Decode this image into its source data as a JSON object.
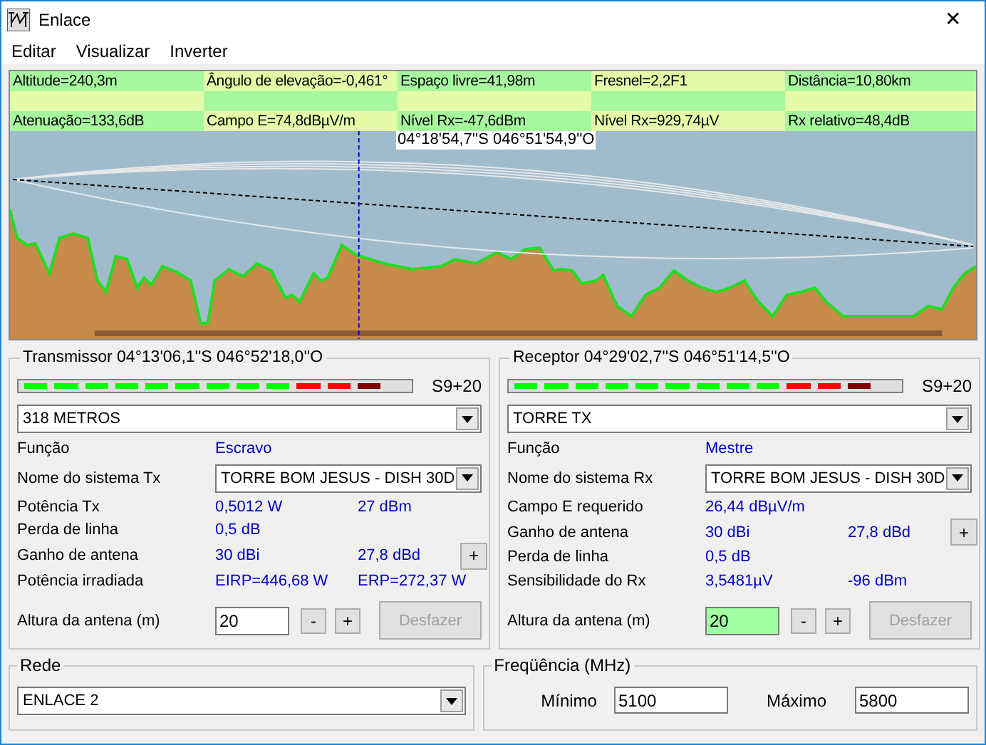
{
  "window": {
    "title": "Enlace",
    "close": "✕"
  },
  "menu": [
    "Editar",
    "Visualizar",
    "Inverter"
  ],
  "info_rows": [
    [
      "Altitude=240,3m",
      "Ângulo de elevação=-0,461°",
      "Espaço livre=41,98m",
      "Fresnel=2,2F1",
      "Distância=10,80km"
    ],
    [
      "Atenuação=133,6dB",
      "Campo E=74,8dBµV/m",
      "Nível Rx=-47,6dBm",
      "Nível Rx=929,74µV",
      "Rx relativo=48,4dB"
    ]
  ],
  "profile": {
    "cursor_label": "04°18'54,7''S 046°51'54,9''O"
  },
  "transmitter": {
    "title": "Transmissor 04°13'06,1''S 046°52'18,0''O",
    "meter": {
      "level": 0.92,
      "reading": "S9+20"
    },
    "site": "318 METROS",
    "rows": [
      {
        "kind": "text",
        "label": "Função",
        "values": [
          "Escravo"
        ]
      },
      {
        "kind": "combo",
        "label": "Nome do sistema Tx",
        "value": "TORRE BOM JESUS - DISH 30D"
      },
      {
        "kind": "text",
        "label": "Potência Tx",
        "values": [
          "0,5012 W",
          "27 dBm"
        ]
      },
      {
        "kind": "text",
        "label": "Perda de linha",
        "values": [
          "0,5 dB"
        ]
      },
      {
        "kind": "button",
        "label": "Ganho de antena",
        "values": [
          "30 dBi",
          "27,8 dBd"
        ],
        "button": "+"
      },
      {
        "kind": "text",
        "label": "Potência irradiada",
        "values": [
          "EIRP=446,68 W",
          "ERP=272,37 W"
        ]
      }
    ],
    "antenna": {
      "label": "Altura da antena (m)",
      "value": "20",
      "highlighted": false,
      "buttons": [
        "-",
        "+"
      ],
      "undo": {
        "label": "Desfazer",
        "disabled": true
      }
    }
  },
  "receiver": {
    "title": "Receptor 04°29'02,7''S 046°51'14,5''O",
    "meter": {
      "level": 0.92,
      "reading": "S9+20"
    },
    "site": "TORRE TX",
    "rows": [
      {
        "kind": "text",
        "label": "Função",
        "values": [
          "Mestre"
        ]
      },
      {
        "kind": "combo",
        "label": "Nome do sistema Rx",
        "value": "TORRE BOM JESUS - DISH 30D"
      },
      {
        "kind": "text",
        "label": "Campo E requerido",
        "values": [
          "26,44 dBµV/m"
        ]
      },
      {
        "kind": "button",
        "label": "Ganho de antena",
        "values": [
          "30 dBi",
          "27,8 dBd"
        ],
        "button": "+"
      },
      {
        "kind": "text",
        "label": "Perda de linha",
        "values": [
          "0,5 dB"
        ]
      },
      {
        "kind": "text",
        "label": "Sensibilidade do Rx",
        "values": [
          "3,5481µV",
          "-96 dBm"
        ]
      }
    ],
    "antenna": {
      "label": "Altura da antena (m)",
      "value": "20",
      "highlighted": true,
      "buttons": [
        "-",
        "+"
      ],
      "undo": {
        "label": "Desfazer",
        "disabled": true
      }
    }
  },
  "network": {
    "title": "Rede",
    "value": "ENLACE 2"
  },
  "frequency": {
    "title": "Freqüência (MHz)",
    "min_label": "Mínimo",
    "min": "5100",
    "max_label": "Máximo",
    "max": "5800"
  }
}
